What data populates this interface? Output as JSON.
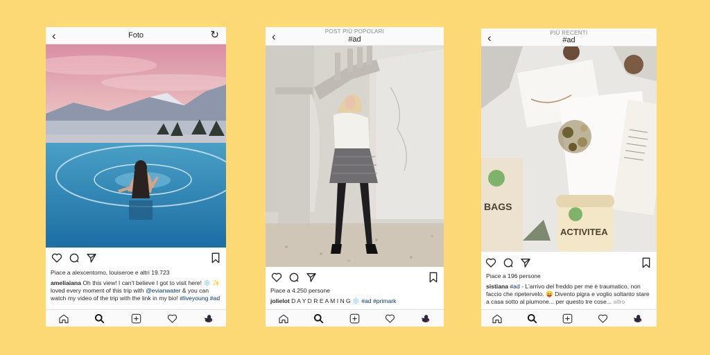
{
  "posts": [
    {
      "header_title": "Foto",
      "header_subtitle": "",
      "likes": "Piace a alexcentomo, louiseroe e altri 19.723",
      "username": "ameliaiana",
      "caption_a": " Oh this view! I can't believe I got to visit here! ",
      "caption_emoji": "❄️ ✨",
      "caption_b": "loved every moment of this trip with ",
      "mention": "@evianwater",
      "caption_c": " & you can watch my video of the trip with the link in my bio! ",
      "hashtags": "#liveyoung #ad",
      "icons": [
        "back-icon",
        "refresh-icon",
        "heart-icon",
        "comment-icon",
        "share-icon",
        "bookmark-icon"
      ]
    },
    {
      "header_title": "#ad",
      "header_subtitle": "POST PIÙ POPOLARI",
      "likes": "Piace a 4.250 persone",
      "username": "jolielot",
      "caption_a": " D A Y D R E A M I N G ",
      "caption_emoji": "❄️",
      "caption_b": " ",
      "mention": "",
      "caption_c": "",
      "hashtags": "#ad #primark"
    },
    {
      "header_title": "#ad",
      "header_subtitle": "PIÙ RECENTI",
      "likes": "Piace a 196 persone",
      "username": "sistiana",
      "caption_a": " ",
      "caption_emoji": "",
      "caption_b": "",
      "mention": "",
      "caption_c": " - L'arrivo del freddo per me è traumatico, non faccio che ripetervelo. 😛 Divento pigra e voglio soltanto stare a casa sotto al piumone... per questo tre cose...",
      "hashtags": "#ad",
      "more": "altro"
    }
  ],
  "nav_icons": [
    "home-icon",
    "search-icon",
    "new-post-icon",
    "activity-heart-icon",
    "profile-avatar-icon"
  ],
  "colors": {
    "background": "#fdd976",
    "link": "#003569"
  }
}
